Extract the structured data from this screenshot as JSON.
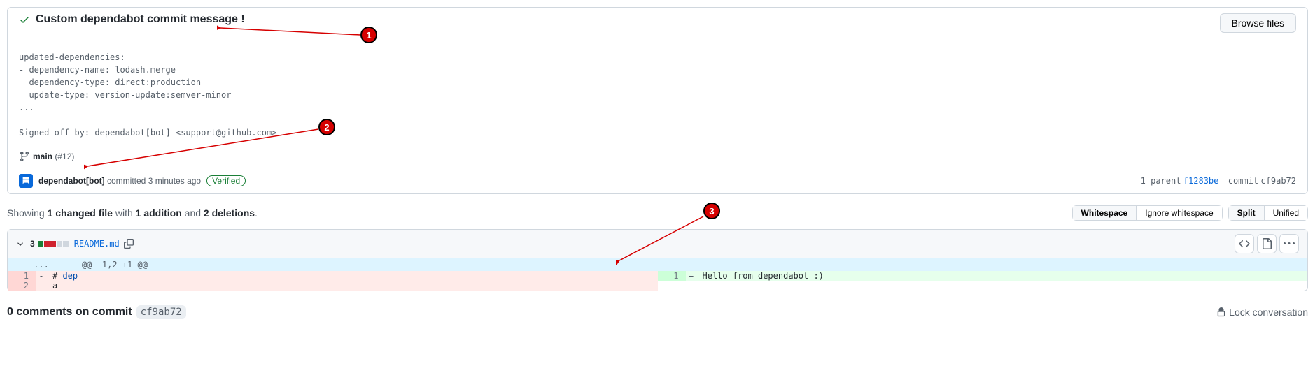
{
  "commit": {
    "title": "Custom dependabot commit message !",
    "description": "---\nupdated-dependencies:\n- dependency-name: lodash.merge\n  dependency-type: direct:production\n  update-type: version-update:semver-minor\n...\n\nSigned-off-by: dependabot[bot] <support@github.com>",
    "browse_button": "Browse files",
    "branch": "main",
    "pr_ref": "(#12)",
    "author": "dependabot[bot]",
    "action": "committed",
    "time": "3 minutes ago",
    "verified": "Verified",
    "parent_label": "1 parent",
    "parent_sha": "f1283be",
    "commit_label": "commit",
    "commit_sha": "cf9ab72"
  },
  "summary": {
    "prefix": "Showing ",
    "files": "1 changed file",
    "mid1": " with ",
    "additions": "1 addition",
    "mid2": " and ",
    "deletions": "2 deletions",
    "suffix": "."
  },
  "toggles": {
    "ws_a": "Whitespace",
    "ws_b": "Ignore whitespace",
    "view_a": "Split",
    "view_b": "Unified"
  },
  "file": {
    "changes": "3",
    "name": "README.md",
    "hunk": "@@ -1,2 +1 @@",
    "hunk_dots": "...",
    "left": [
      {
        "num": "1",
        "sign": "-",
        "code_prefix": "# ",
        "code_kw": "dep"
      },
      {
        "num": "2",
        "sign": "-",
        "code_plain": "a"
      }
    ],
    "right": [
      {
        "num": "1",
        "sign": "+",
        "code_plain": "Hello from dependabot :)"
      }
    ]
  },
  "comments": {
    "title": "0 comments on commit",
    "sha": "cf9ab72",
    "lock": "Lock conversation"
  },
  "annotations": {
    "a1": "1",
    "a2": "2",
    "a3": "3"
  }
}
